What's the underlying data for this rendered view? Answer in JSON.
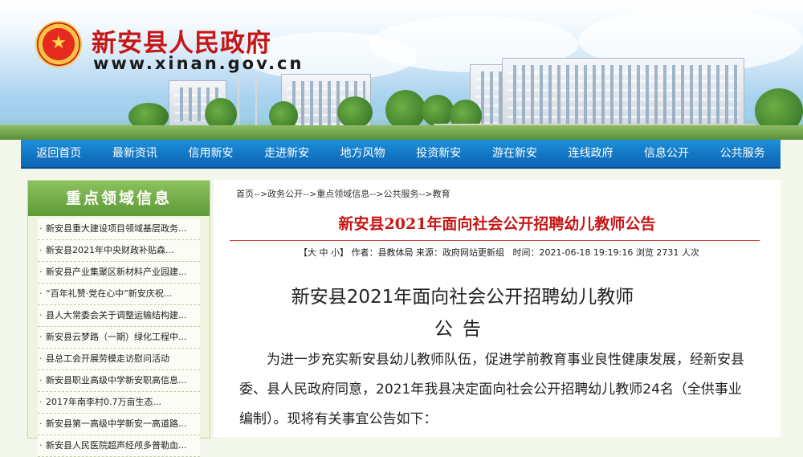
{
  "header": {
    "site_title": "新安县人民政府",
    "site_url": "www.xinan.gov.cn",
    "emblem_glyph": "★"
  },
  "nav": {
    "items": [
      "返回首页",
      "最新资讯",
      "信用新安",
      "走进新安",
      "地方风物",
      "投资新安",
      "游在新安",
      "连线政府",
      "信息公开",
      "公共服务"
    ]
  },
  "sidebar": {
    "title": "重点领域信息",
    "items": [
      "新安县重大建设项目领域基层政务...",
      "新安县2021年中央财政补贴森...",
      "新安县产业集聚区新材料产业园建...",
      "“百年礼赞·党在心中”新安庆祝...",
      "县人大常委会关于调整运输结构建...",
      "新安县云梦路（一期）绿化工程中...",
      "县总工会开展劳模走访慰问活动",
      "新安县职业高级中学新安职高信息...",
      "2017年南李村0.7万亩生态...",
      "新安县第一高级中学新安一高道路...",
      "新安县人民医院超声经颅多普勒血..."
    ]
  },
  "breadcrumb": {
    "items": [
      "首页",
      "政务公开",
      "重点领域信息",
      "公共服务",
      "教育"
    ],
    "separator": "-->"
  },
  "article": {
    "title": "新安县2021年面向社会公开招聘幼儿教师公告",
    "meta": {
      "open": "【",
      "size_large": "大",
      "size_medium": "中",
      "size_small": "小",
      "close": "】",
      "author": "作者：县教体局",
      "source": "来源：政府网站更新组",
      "time": "时间：2021-06-18 19:19:16",
      "views": "浏览 2731 人次"
    },
    "heading_line1": "新安县2021年面向社会公开招聘幼儿教师",
    "heading_line2": "公告",
    "body": "为进一步充实新安县幼儿教师队伍，促进学前教育事业良性健康发展，经新安县委、县人民政府同意，2021年我县决定面向社会公开招聘幼儿教师24名（全供事业编制）。现将有关事宜公告如下："
  },
  "colors": {
    "brand_red": "#c61616",
    "nav_blue": "#0b64b3",
    "sidebar_green": "#5e9a36"
  }
}
